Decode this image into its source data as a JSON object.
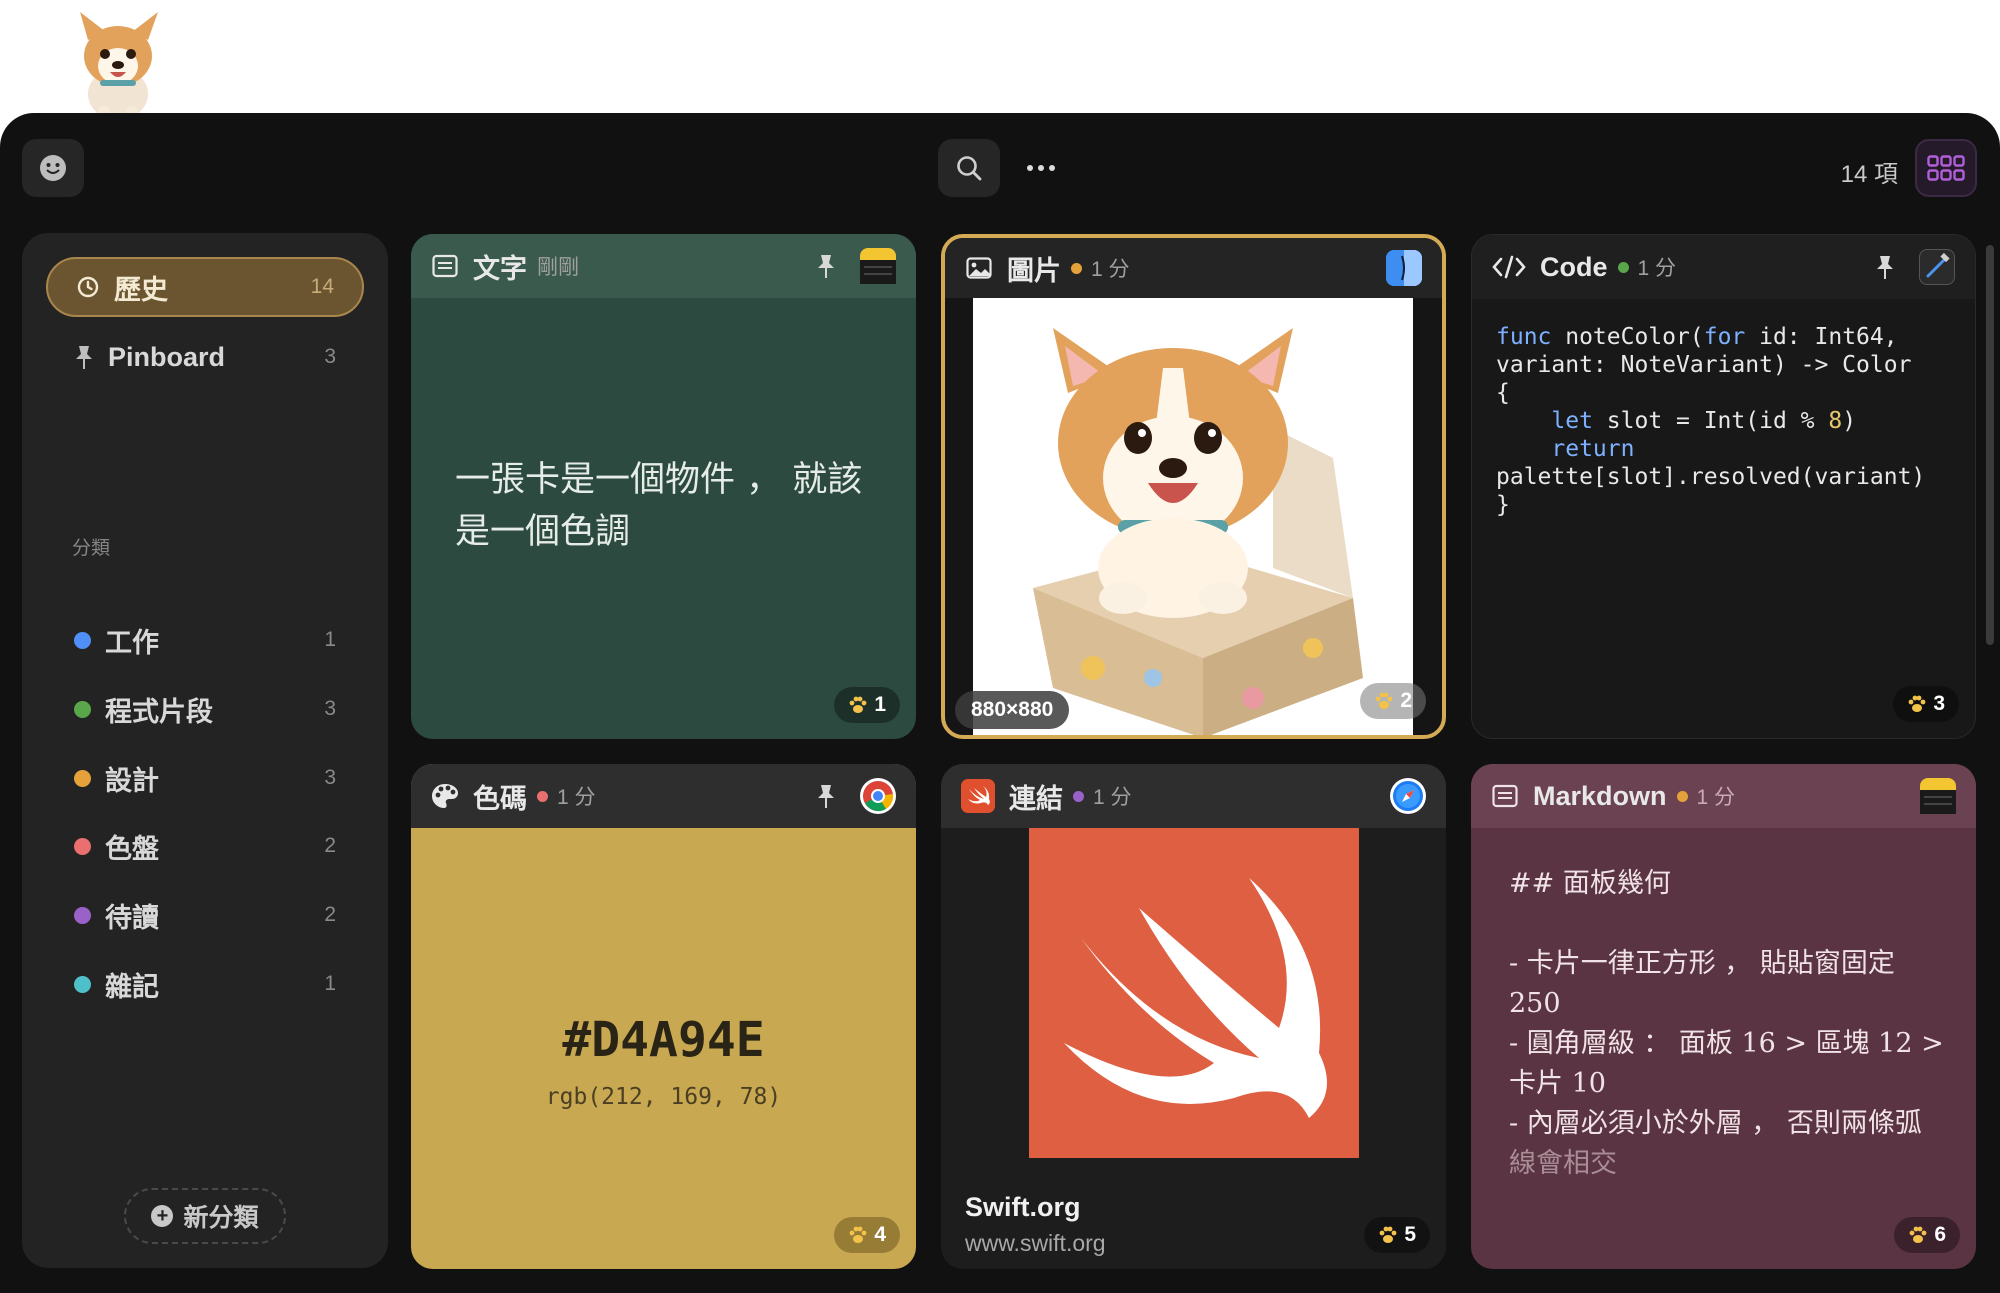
{
  "header": {
    "item_count": "14 項"
  },
  "sidebar": {
    "items": [
      {
        "label": "歷史",
        "count": "14"
      },
      {
        "label": "Pinboard",
        "count": "3"
      }
    ],
    "section_label": "分類",
    "categories": [
      {
        "label": "工作",
        "count": "1",
        "color": "#4f8ff7"
      },
      {
        "label": "程式片段",
        "count": "3",
        "color": "#5aa64a"
      },
      {
        "label": "設計",
        "count": "3",
        "color": "#e5a23a"
      },
      {
        "label": "色盤",
        "count": "2",
        "color": "#ea6f6f"
      },
      {
        "label": "待讀",
        "count": "2",
        "color": "#9a62c9"
      },
      {
        "label": "雜記",
        "count": "1",
        "color": "#4fc0c9"
      }
    ],
    "new_category": "新分類"
  },
  "cards": {
    "text": {
      "type": "文字",
      "time": "剛剛",
      "body": "一張卡是一個物件 ， 就該是一個色調",
      "paw": "1"
    },
    "image": {
      "type": "圖片",
      "time": "1 分",
      "dimensions": "880×880",
      "paw": "2",
      "dot_color": "#e5a23a"
    },
    "code": {
      "type": "Code",
      "time": "1 分",
      "paw": "3",
      "dot_color": "#5aa64a",
      "lines": {
        "l1_kw": "func",
        "l1_a": " noteColor(",
        "l1_kw2": "for",
        "l1_b": " id: Int64,",
        "l2": "variant: NoteVariant) -> Color",
        "l3": "{",
        "l4_kw": "let",
        "l4_a": " slot = Int(id % ",
        "l4_num": "8",
        "l4_b": ")",
        "l5_kw": "return",
        "l6": "palette[slot].resolved(variant)",
        "l7": "}"
      }
    },
    "color": {
      "type": "色碼",
      "time": "1 分",
      "hex": "#D4A94E",
      "rgb": "rgb(212, 169, 78)",
      "paw": "4",
      "dot_color": "#ea6f6f",
      "swatch": "#d4a94e"
    },
    "link": {
      "type": "連結",
      "time": "1 分",
      "title": "Swift.org",
      "url": "www.swift.org",
      "paw": "5",
      "dot_color": "#9a62c9"
    },
    "markdown": {
      "type": "Markdown",
      "time": "1 分",
      "paw": "6",
      "dot_color": "#e5a23a",
      "heading": "## 面板幾何",
      "line1": "- 卡片一律正方形 ， 貼貼窗固定 250",
      "line2": "- 圓角層級 ： 面板 16 > 區塊 12 > 卡片 10",
      "line3": "- 內層必須小於外層 ， 否則兩條弧",
      "line4": "線會相交"
    }
  }
}
